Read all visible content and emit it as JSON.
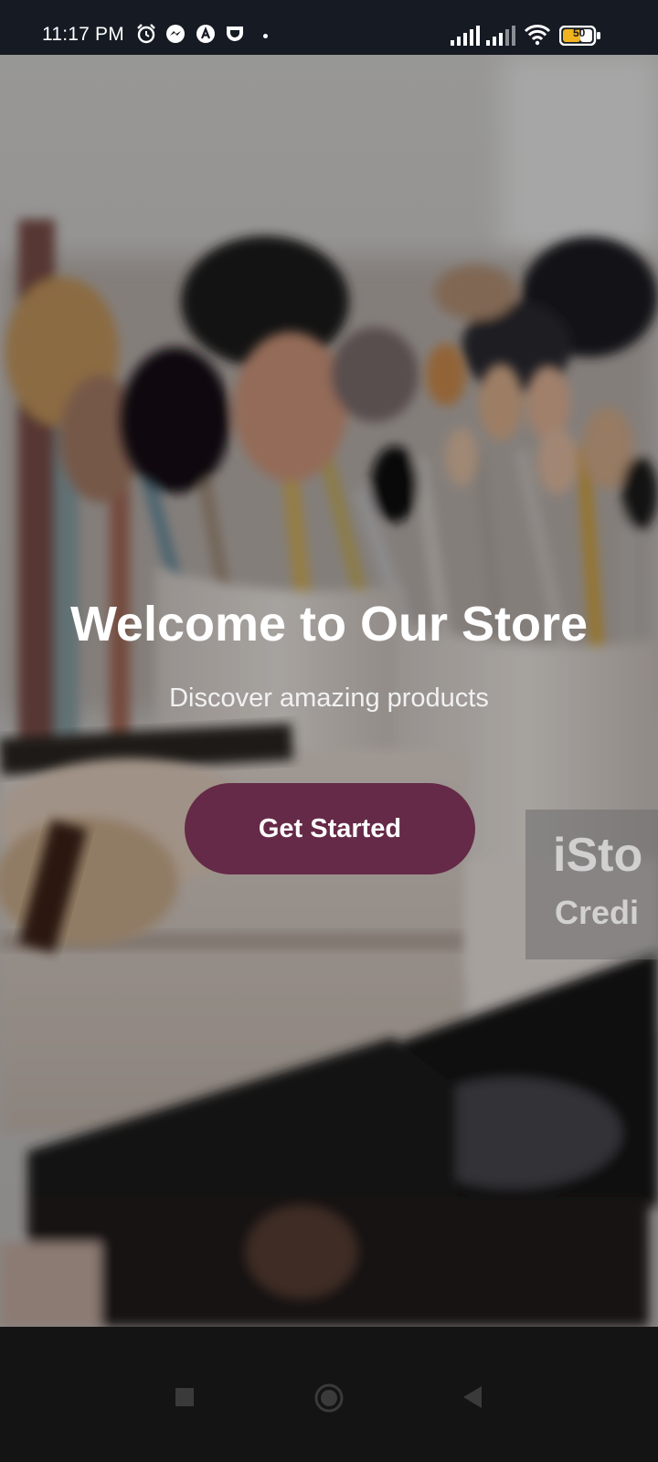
{
  "status_bar": {
    "time": "11:17 PM",
    "battery": "50",
    "icons": [
      "alarm-icon",
      "messenger-icon",
      "app-a-icon",
      "app-shield-icon",
      "signal-icon",
      "signal-icon",
      "wifi-icon",
      "battery-icon"
    ]
  },
  "hero": {
    "title": "Welcome to Our Store",
    "subtitle": "Discover amazing products",
    "button_label": "Get Started",
    "watermark": "iSto",
    "watermark_sub": "Credi"
  },
  "colors": {
    "button": "#652a47",
    "status_bar": "#151a23",
    "nav_bar": "#141414"
  },
  "nav_bar": {
    "buttons": [
      "recents-square-icon",
      "home-circle-icon",
      "back-triangle-icon"
    ]
  }
}
